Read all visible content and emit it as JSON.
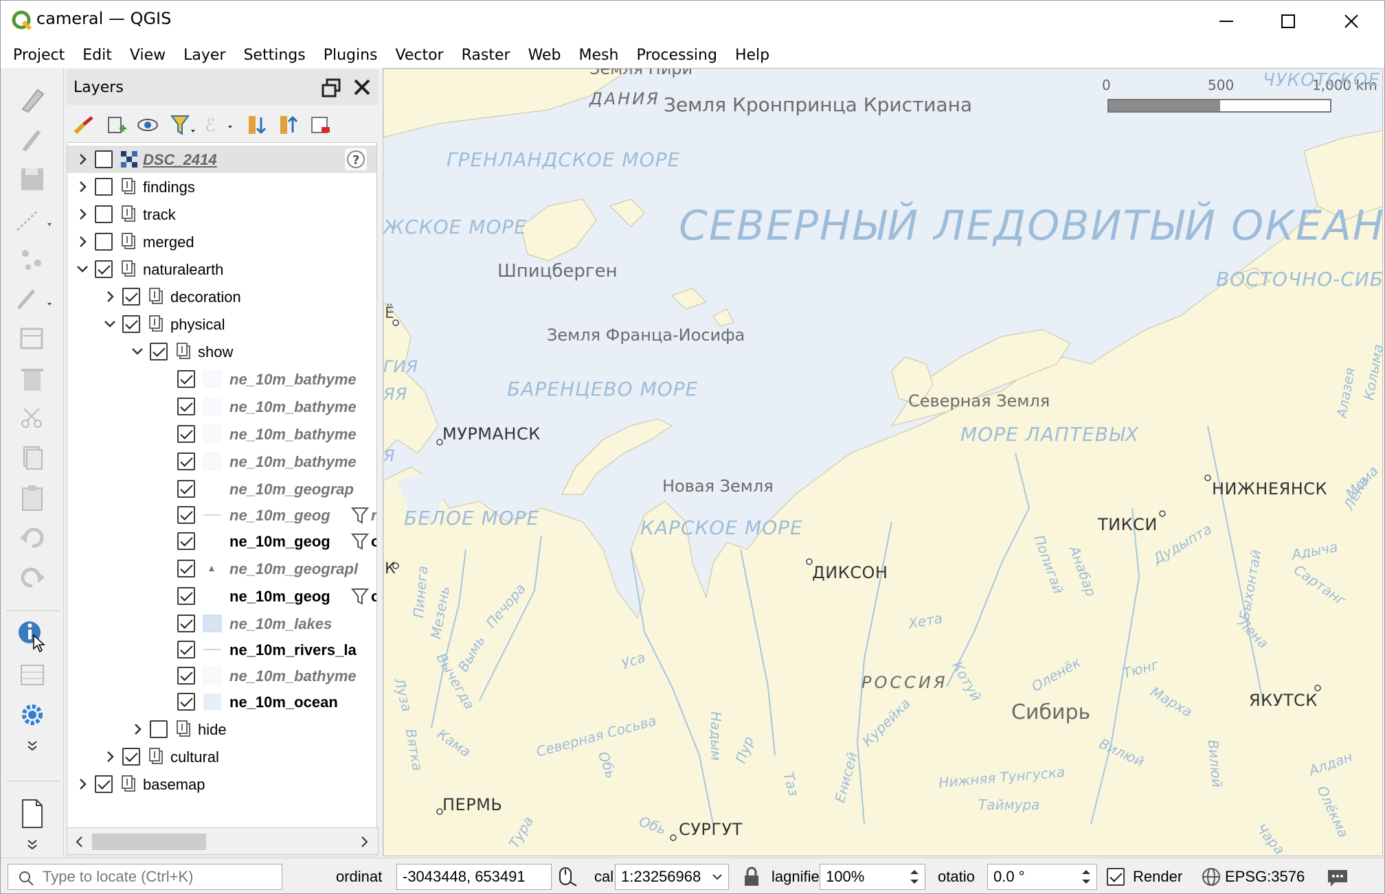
{
  "window": {
    "title": "cameral — QGIS"
  },
  "menu": [
    "Project",
    "Edit",
    "View",
    "Layer",
    "Settings",
    "Plugins",
    "Vector",
    "Raster",
    "Web",
    "Mesh",
    "Processing",
    "Help"
  ],
  "layers_panel": {
    "title": "Layers",
    "rows": [
      {
        "label": "DSC_2414",
        "checked": false
      },
      {
        "label": "findings",
        "checked": false
      },
      {
        "label": "track",
        "checked": false
      },
      {
        "label": "merged",
        "checked": false
      },
      {
        "label": "naturalearth",
        "checked": true
      },
      {
        "label": "decoration",
        "checked": true
      },
      {
        "label": "physical",
        "checked": true
      },
      {
        "label": "show",
        "checked": true
      },
      {
        "label": "ne_10m_bathyme",
        "checked": true
      },
      {
        "label": "ne_10m_bathyme",
        "checked": true
      },
      {
        "label": "ne_10m_bathyme",
        "checked": true
      },
      {
        "label": "ne_10m_bathyme",
        "checked": true
      },
      {
        "label": "ne_10m_geograp",
        "checked": true
      },
      {
        "label": "ne_10m_geog",
        "label2": "rı",
        "checked": true
      },
      {
        "label": "ne_10m_geog",
        "label2": "ol",
        "checked": true
      },
      {
        "label": "ne_10m_geograpl",
        "checked": true
      },
      {
        "label": "ne_10m_geog",
        "label2": "ol",
        "checked": true
      },
      {
        "label": "ne_10m_lakes",
        "checked": true
      },
      {
        "label": "ne_10m_rivers_la",
        "checked": true
      },
      {
        "label": "ne_10m_bathyme",
        "checked": true
      },
      {
        "label": "ne_10m_ocean",
        "checked": true
      },
      {
        "label": "hide",
        "checked": false
      },
      {
        "label": "cultural",
        "checked": true
      },
      {
        "label": "basemap",
        "checked": true
      }
    ]
  },
  "map": {
    "scalebar": {
      "ticks": [
        "0",
        "500",
        "1,000 km"
      ]
    },
    "labels": {
      "dania": "ДАНИЯ",
      "kronprinz": "Земля Кронпринца Кристиана",
      "piri": "Земля Пири",
      "chukotskoe": "ЧУКОТСКОЕ",
      "greenland_sea": "ГРЕНЛАНДСКОЕ МОРЕ",
      "norwegian_sea": "ЖСКОЕ МОРЕ",
      "arctic_ocean": "СЕВЕРНЫЙ ЛЕДОВИТЫЙ ОКЕАН",
      "east_siberian": "ВОСТОЧНО-СИБИ",
      "spitsbergen": "Шпицберген",
      "franz_josef": "Земля Франца-Иосифа",
      "barents": "БАРЕНЦЕВО МОРЕ",
      "severnaya_zemlya": "Северная Земля",
      "laptev": "МОРЕ ЛАПТЕВЫХ",
      "murmansk": "МУРМАНСК",
      "novaya_zemlya": "Новая Земля",
      "white_sea": "БЕЛОЕ МОРЕ",
      "kara": "КАРСКОЕ МОРЕ",
      "dikson": "ДИКСОН",
      "tiksi": "ТИКСИ",
      "nizhneyansk": "НИЖНЕЯНСК",
      "russia": "РОССИЯ",
      "siberia": "Сибирь",
      "yakutsk": "ЯКУТСК",
      "perm": "ПЕРМЬ",
      "surgut": "СУРГУТ",
      "edge_e": "Ё",
      "edge_giya": "ГИЯ",
      "edge_ya": "ЯЯ",
      "edge_k": "К",
      "edge_ya2": "Я"
    },
    "rivers": [
      "Мезень",
      "Печора",
      "Вымь",
      "Вычегда",
      "Луза",
      "Вятка",
      "Кама",
      "Северная Сосьва",
      "Уса",
      "Обь",
      "Надым",
      "Пур",
      "Таз",
      "Обь",
      "Тура",
      "Енисей",
      "Курейка",
      "Котуй",
      "Хета",
      "Оленёк",
      "Попигай",
      "Анабар",
      "Тюнг",
      "Марха",
      "Вилюй",
      "Вилюй",
      "Нижняя Тунгуска",
      "Таймура",
      "Лена",
      "Быхонтай",
      "Адыча",
      "Сартанг",
      "Лена",
      "Алдан",
      "Олёкма",
      "Чара",
      "Мома",
      "Колыма",
      "Алазея",
      "Дудыпта",
      "Пинега"
    ]
  },
  "statusbar": {
    "locate_placeholder": "Type to locate (Ctrl+K)",
    "coord_label": "ordinat",
    "coord_value": "-3043448, 653491",
    "scale_label": "cal",
    "scale_value": "1:23256968",
    "magnifier_label": "lagnifie",
    "magnifier_value": "100%",
    "rotation_label": "otatio",
    "rotation_value": "0.0 °",
    "render_label": "Render",
    "render_checked": true,
    "crs": "EPSG:3576"
  }
}
